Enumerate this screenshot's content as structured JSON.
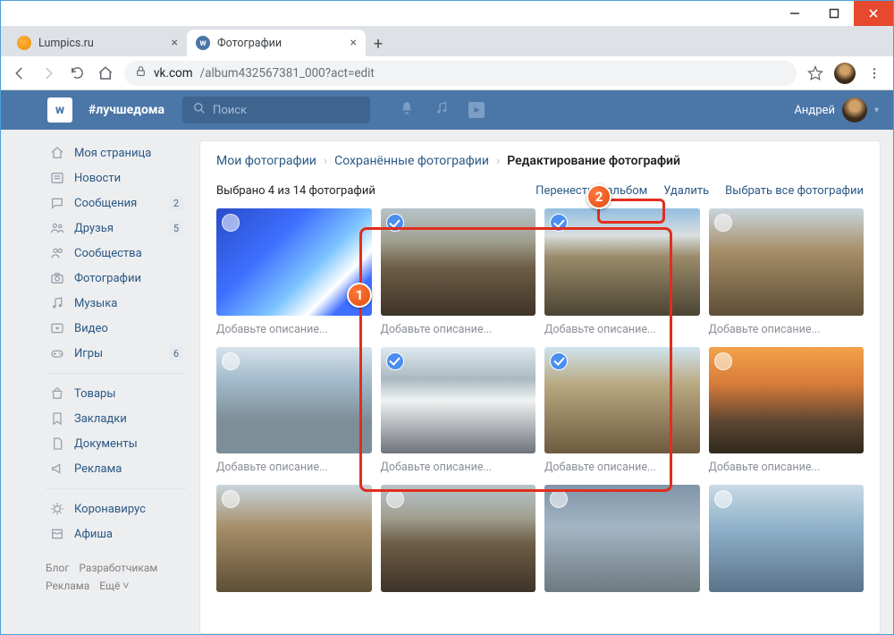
{
  "browser": {
    "tabs": [
      {
        "title": "Lumpics.ru"
      },
      {
        "title": "Фотографии"
      }
    ],
    "url_host": "vk.com",
    "url_path": "/album432567381_000?act=edit"
  },
  "vk_header": {
    "hashtag": "#лучшедома",
    "search_placeholder": "Поиск",
    "username": "Андрей"
  },
  "sidebar": {
    "items": [
      {
        "icon": "home",
        "label": "Моя страница"
      },
      {
        "icon": "news",
        "label": "Новости"
      },
      {
        "icon": "msg",
        "label": "Сообщения",
        "badge": "2"
      },
      {
        "icon": "friends",
        "label": "Друзья",
        "badge": "5"
      },
      {
        "icon": "groups",
        "label": "Сообщества"
      },
      {
        "icon": "photos",
        "label": "Фотографии"
      },
      {
        "icon": "music",
        "label": "Музыка"
      },
      {
        "icon": "video",
        "label": "Видео"
      },
      {
        "icon": "games",
        "label": "Игры",
        "badge": "6"
      }
    ],
    "items2": [
      {
        "icon": "market",
        "label": "Товары"
      },
      {
        "icon": "bookmarks",
        "label": "Закладки"
      },
      {
        "icon": "docs",
        "label": "Документы"
      },
      {
        "icon": "ads",
        "label": "Реклама"
      }
    ],
    "items3": [
      {
        "icon": "virus",
        "label": "Коронавирус"
      },
      {
        "icon": "afisha",
        "label": "Афиша"
      }
    ],
    "footer": [
      "Блог",
      "Разработчикам",
      "Реклама",
      "Ещё ˅"
    ]
  },
  "main": {
    "breadcrumbs": {
      "a": "Мои фотографии",
      "b": "Сохранённые фотографии",
      "c": "Редактирование фотографий"
    },
    "selection_text": "Выбрано 4 из 14 фотографий",
    "actions": {
      "move": "Перенести в альбом",
      "delete": "Удалить",
      "select_all": "Выбрать все фотографии"
    },
    "caption_placeholder": "Добавьте описание...",
    "photos": [
      {
        "cls": "t0",
        "selected": false
      },
      {
        "cls": "t-village",
        "selected": true
      },
      {
        "cls": "t-cliff",
        "selected": true
      },
      {
        "cls": "t-canyon",
        "selected": false
      },
      {
        "cls": "t-city",
        "selected": false
      },
      {
        "cls": "t-clouds",
        "selected": true
      },
      {
        "cls": "t-bridge",
        "selected": true
      },
      {
        "cls": "t-sunset",
        "selected": false
      },
      {
        "cls": "t-canyon",
        "selected": false
      },
      {
        "cls": "t-village",
        "selected": false
      },
      {
        "cls": "t-rainbow",
        "selected": false
      },
      {
        "cls": "t-climber",
        "selected": false
      }
    ]
  }
}
